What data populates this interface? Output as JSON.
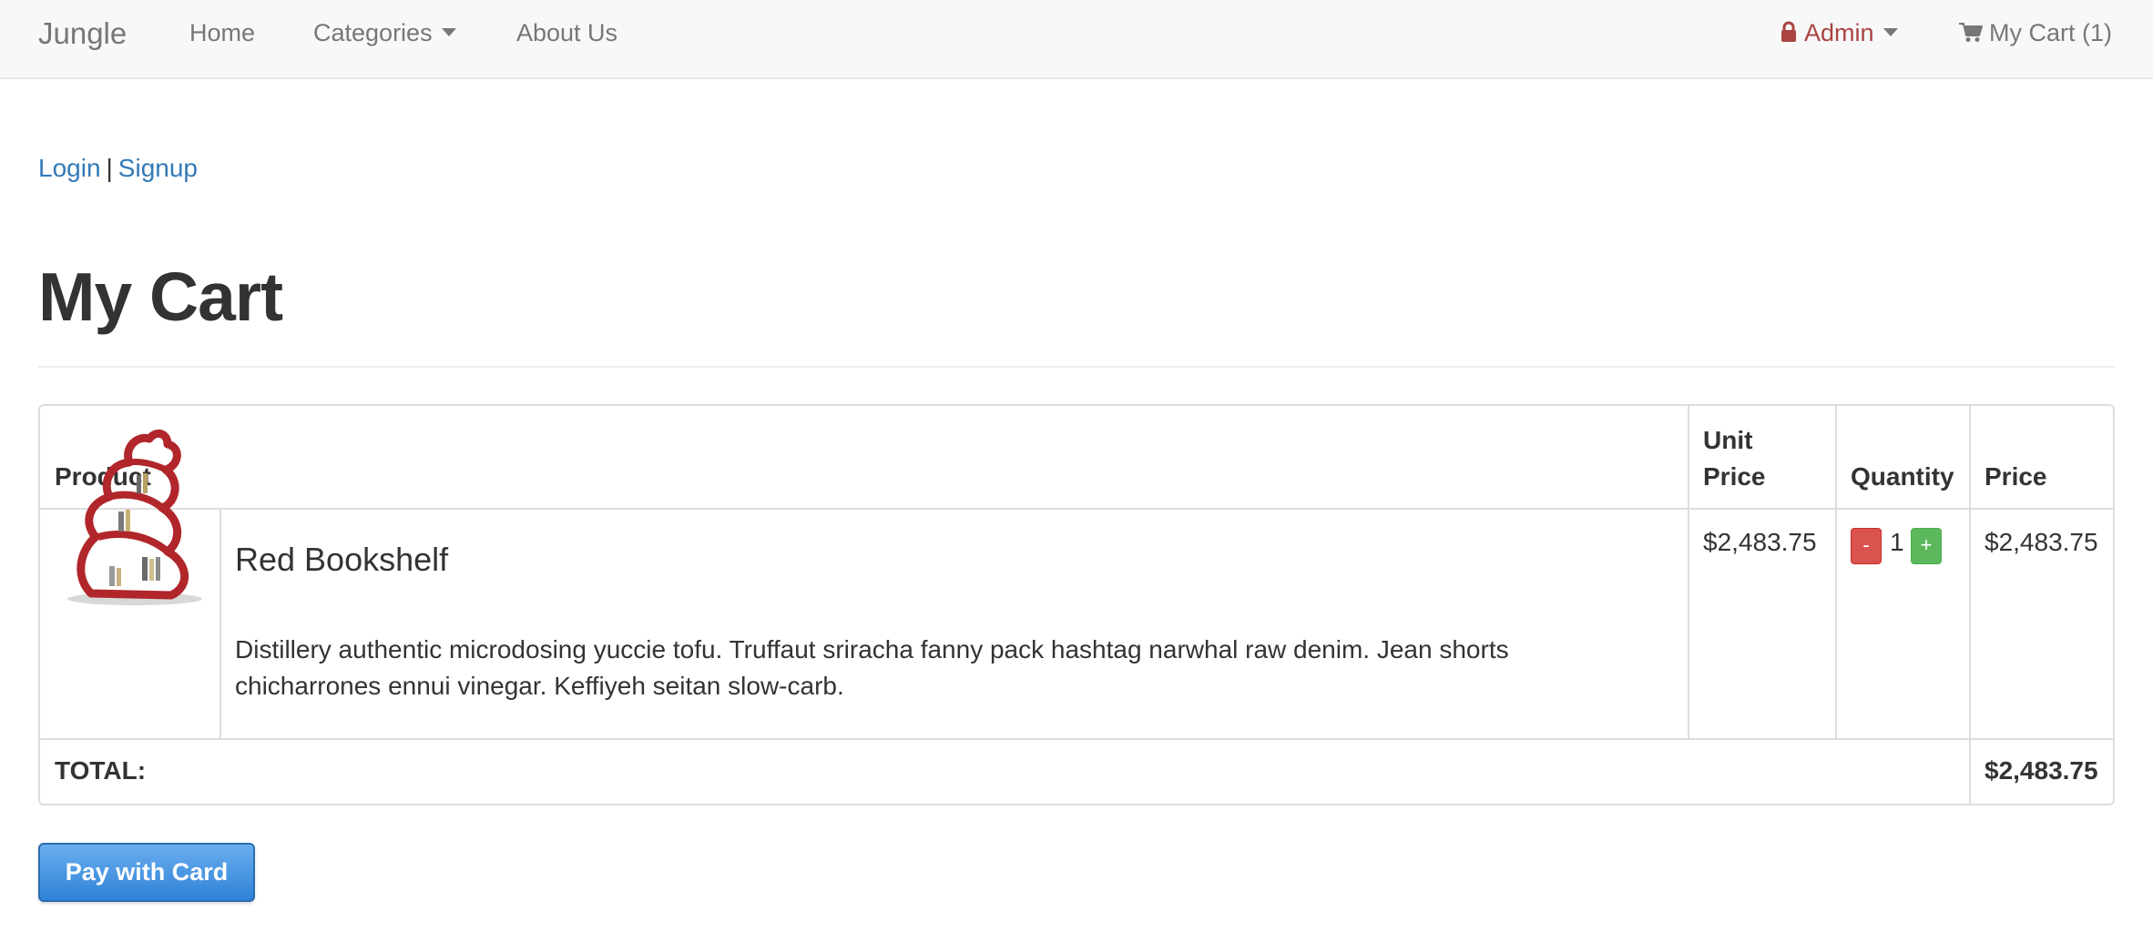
{
  "navbar": {
    "brand": "Jungle",
    "home": "Home",
    "categories": "Categories",
    "about": "About Us",
    "admin": "Admin",
    "cart": "My Cart (1)"
  },
  "auth": {
    "login": "Login",
    "separator": "|",
    "signup": "Signup"
  },
  "page_title": "My Cart",
  "table": {
    "headers": {
      "product": "Product",
      "unit_price": "Unit Price",
      "quantity": "Quantity",
      "price": "Price"
    },
    "items": [
      {
        "name": "Red Bookshelf",
        "description": "Distillery authentic microdosing yuccie tofu. Truffaut sriracha fanny pack hashtag narwhal raw denim. Jean shorts chicharrones ennui vinegar. Keffiyeh seitan slow-carb.",
        "unit_price": "$2,483.75",
        "quantity": "1",
        "price": "$2,483.75",
        "minus_label": "-",
        "plus_label": "+"
      }
    ],
    "total_label": "TOTAL:",
    "total_value": "$2,483.75"
  },
  "pay_button": "Pay with Card",
  "colors": {
    "link": "#337ab7",
    "admin": "#a94442",
    "minus_button": "#d9534f",
    "plus_button": "#5cb85c",
    "pay_button": "#3a8ee0"
  },
  "icons": {
    "admin": "lock-icon",
    "cart": "shopping-cart-icon",
    "dropdown": "caret-down-icon"
  }
}
